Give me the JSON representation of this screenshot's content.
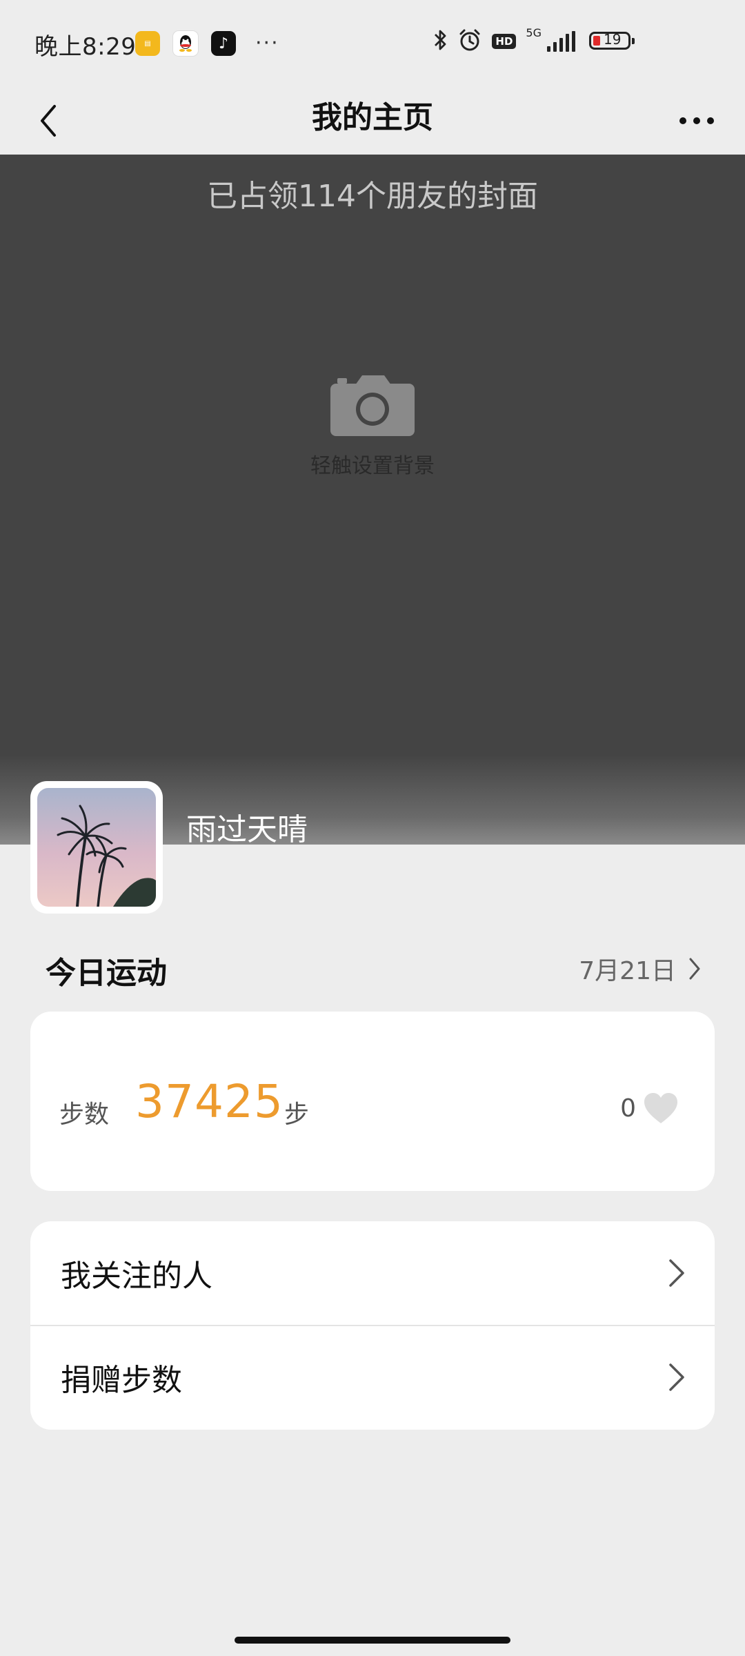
{
  "status_bar": {
    "time": "晚上8:29",
    "notification_apps": [
      "yellow-app-icon",
      "qq-icon",
      "tiktok-icon"
    ],
    "more_notifications": "···",
    "hd_label": "HD",
    "network_label": "5G",
    "battery_level": "19",
    "signal_bars": 4
  },
  "header": {
    "title": "我的主页"
  },
  "cover": {
    "caption": "已占领114个朋友的封面",
    "set_background_label": "轻触设置背景"
  },
  "profile": {
    "username": "雨过天晴"
  },
  "today_sport": {
    "title": "今日运动",
    "date": "7月21日"
  },
  "steps": {
    "label": "步数",
    "value": "37425",
    "unit": "步",
    "likes": "0"
  },
  "menu": {
    "items": [
      {
        "label": "我关注的人"
      },
      {
        "label": "捐赠步数"
      }
    ]
  },
  "colors": {
    "accent_orange": "#ed9b2e",
    "cover_bg": "#444444",
    "page_bg": "#ededed",
    "battery_low": "#e02b2b"
  }
}
